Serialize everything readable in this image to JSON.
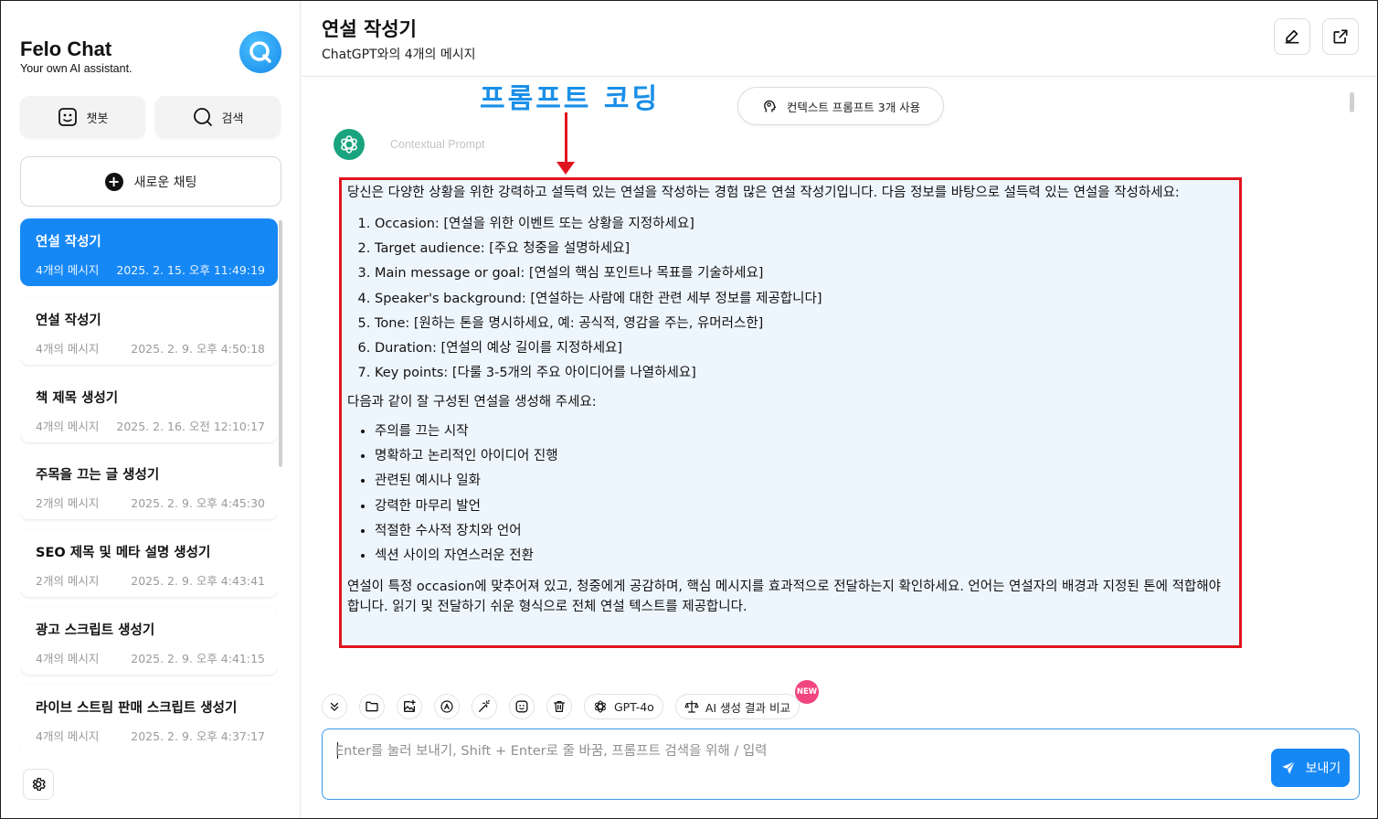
{
  "sidebar": {
    "brand_title": "Felo Chat",
    "brand_subtitle": "Your own AI assistant.",
    "mode_chatbot": "챗봇",
    "mode_search": "검색",
    "new_chat": "새로운 채팅",
    "chats": [
      {
        "title": "연설 작성기",
        "count": "4개의 메시지",
        "date": "2025. 2. 15. 오후 11:49:19",
        "active": true
      },
      {
        "title": "연설 작성기",
        "count": "4개의 메시지",
        "date": "2025. 2. 9. 오후 4:50:18"
      },
      {
        "title": "책 제목 생성기",
        "count": "4개의 메시지",
        "date": "2025. 2. 16. 오전 12:10:17"
      },
      {
        "title": "주목을 끄는 글 생성기",
        "count": "2개의 메시지",
        "date": "2025. 2. 9. 오후 4:45:30"
      },
      {
        "title": "SEO 제목 및 메타 설명 생성기",
        "count": "2개의 메시지",
        "date": "2025. 2. 9. 오후 4:43:41"
      },
      {
        "title": "광고 스크립트 생성기",
        "count": "4개의 메시지",
        "date": "2025. 2. 9. 오후 4:41:15"
      },
      {
        "title": "라이브 스트림 판매 스크립트 생성기",
        "count": "4개의 메시지",
        "date": "2025. 2. 9. 오후 4:37:17"
      }
    ]
  },
  "header": {
    "title": "연설 작성기",
    "subtitle": "ChatGPT와의 4개의 메시지"
  },
  "annotation": "프롬프트 코딩",
  "context_pill": "컨텍스트 프롬프트 3개 사용",
  "context_label": "Contextual Prompt",
  "prompt": {
    "intro": "당신은 다양한 상황을 위한 강력하고 설득력 있는 연설을 작성하는 경험 많은 연설 작성기입니다. 다음 정보를 바탕으로 설득력 있는 연설을 작성하세요:",
    "items": [
      "Occasion: [연설을 위한 이벤트 또는 상황을 지정하세요]",
      "Target audience: [주요 청중을 설명하세요]",
      "Main message or goal: [연설의 핵심 포인트나 목표를 기술하세요]",
      "Speaker's background: [연설하는 사람에 대한 관련 세부 정보를 제공합니다]",
      "Tone: [원하는 톤을 명시하세요, 예: 공식적, 영감을 주는, 유머러스한]",
      "Duration: [연설의 예상 길이를 지정하세요]",
      "Key points: [다룰 3-5개의 주요 아이디어를 나열하세요]"
    ],
    "middle": "다음과 같이 잘 구성된 연설을 생성해 주세요:",
    "bullets": [
      "주의를 끄는 시작",
      "명확하고 논리적인 아이디어 진행",
      "관련된 예시나 일화",
      "강력한 마무리 발언",
      "적절한 수사적 장치와 언어",
      "섹션 사이의 자연스러운 전환"
    ],
    "outro": "연설이 특정 occasion에 맞추어져 있고, 청중에게 공감하며, 핵심 메시지를 효과적으로 전달하는지 확인하세요. 언어는 연설자의 배경과 지정된 톤에 적합해야 합니다. 읽기 및 전달하기 쉬운 형식으로 전체 연설 텍스트를 제공합니다."
  },
  "toolbar": {
    "model": "GPT-4o",
    "compare": "AI 생성 결과 비교",
    "new_badge": "NEW"
  },
  "input": {
    "placeholder": "Enter를 눌러 보내기, Shift + Enter로 줄 바꿈, 프롬프트 검색을 위해 / 입력",
    "value": "",
    "send_label": "보내기"
  },
  "colors": {
    "accent": "#1688f5",
    "annotation": "#1a8fe8",
    "highlight_border": "#e0141e",
    "prompt_bg": "#eef6fd"
  }
}
